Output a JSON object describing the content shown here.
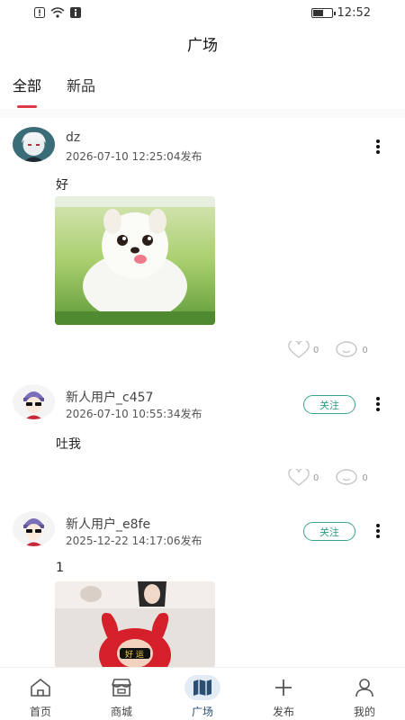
{
  "status_bar": {
    "time": "12:52",
    "icons": [
      "alert-icon",
      "wifi-icon",
      "info-icon",
      "battery-icon"
    ],
    "battery_level": 0.6
  },
  "header": {
    "title": "广场"
  },
  "tabs": [
    {
      "label": "全部",
      "active": true
    },
    {
      "label": "新品",
      "active": false
    }
  ],
  "posts": [
    {
      "username": "dz",
      "time": "2026-07-10 12:25:04发布",
      "text": "好",
      "follow_label": "",
      "has_image": true,
      "image_caption": "可爱白色小狗",
      "likes": "0",
      "comments": "0"
    },
    {
      "username": "新人用户_c457",
      "time": "2026-07-10 10:55:34发布",
      "text": "吐我",
      "follow_label": "关注",
      "has_image": false,
      "likes": "0",
      "comments": "0"
    },
    {
      "username": "新人用户_e8fe",
      "time": "2025-12-22 14:17:06发布",
      "text": "1",
      "follow_label": "关注",
      "has_image": true,
      "image_caption": "好运",
      "likes": "",
      "comments": ""
    }
  ],
  "bottom_nav": [
    {
      "label": "首页",
      "icon": "home-icon",
      "active": false
    },
    {
      "label": "商城",
      "icon": "store-icon",
      "active": false
    },
    {
      "label": "广场",
      "icon": "map-icon",
      "active": true
    },
    {
      "label": "发布",
      "icon": "plus-icon",
      "active": false
    },
    {
      "label": "我的",
      "icon": "user-icon",
      "active": false
    }
  ],
  "colors": {
    "accent_red": "#e0394a",
    "follow_green": "#3aa58f",
    "nav_active": "#2a4f73"
  }
}
